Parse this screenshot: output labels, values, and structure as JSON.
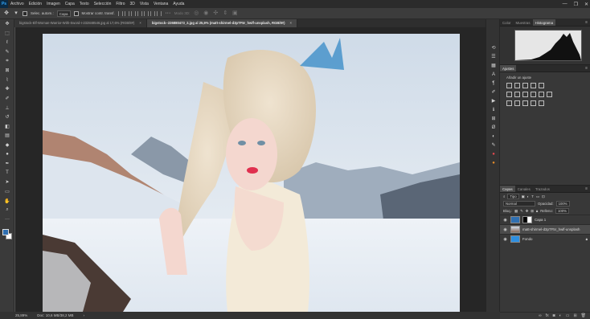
{
  "app": {
    "logo": "Ps"
  },
  "menu": [
    "Archivo",
    "Edición",
    "Imagen",
    "Capa",
    "Texto",
    "Selección",
    "Filtro",
    "3D",
    "Vista",
    "Ventana",
    "Ayuda"
  ],
  "window_controls": [
    "—",
    "❐",
    "✕"
  ],
  "options": {
    "auto_select_label": "Selec. autom.:",
    "auto_select_value": "Capa",
    "transform_label": "Mostrar contr. transf.",
    "mode_3d_label": "Modo 3D:"
  },
  "tabs": [
    {
      "label": "bigstock-Elf-Woman-Warrior-With-Sword-I-232848546.jpg al 17,6% (RGB/8#)",
      "active": false
    },
    {
      "label": "bigstock--226880473_2.jpg al 25,9% (matt-shirmel-d3pTF5r_hwlf-unsplash, RGB/8#)",
      "active": true
    }
  ],
  "status": {
    "zoom": "25,89%",
    "doc": "Doc: 10,6 MB/38,2 MB"
  },
  "panels": {
    "color_tabs": [
      "Color",
      "Muestras",
      "Histograma"
    ],
    "adjust_tabs": [
      "Ajustes"
    ],
    "adjust_title": "Añadir un ajuste",
    "layers_tabs": [
      "Capas",
      "Canales",
      "Trazados"
    ],
    "filter_label": "Tipo",
    "blend_mode": "Normal",
    "opacity_label": "Opacidad:",
    "opacity_value": "100%",
    "lock_label": "Bloq.:",
    "fill_label": "Relleno:",
    "fill_value": "100%",
    "layers": [
      {
        "name": "Capa 1",
        "selected": false,
        "kind": "mask"
      },
      {
        "name": "matt-shirmel-d3pTF5r_hwlf-unsplash",
        "selected": true,
        "kind": "photo"
      },
      {
        "name": "Fondo",
        "selected": false,
        "kind": "blue"
      }
    ]
  },
  "colors": {
    "accent": "#31a8ff",
    "foreground": "#2f6fb1",
    "background": "#ffffff"
  }
}
